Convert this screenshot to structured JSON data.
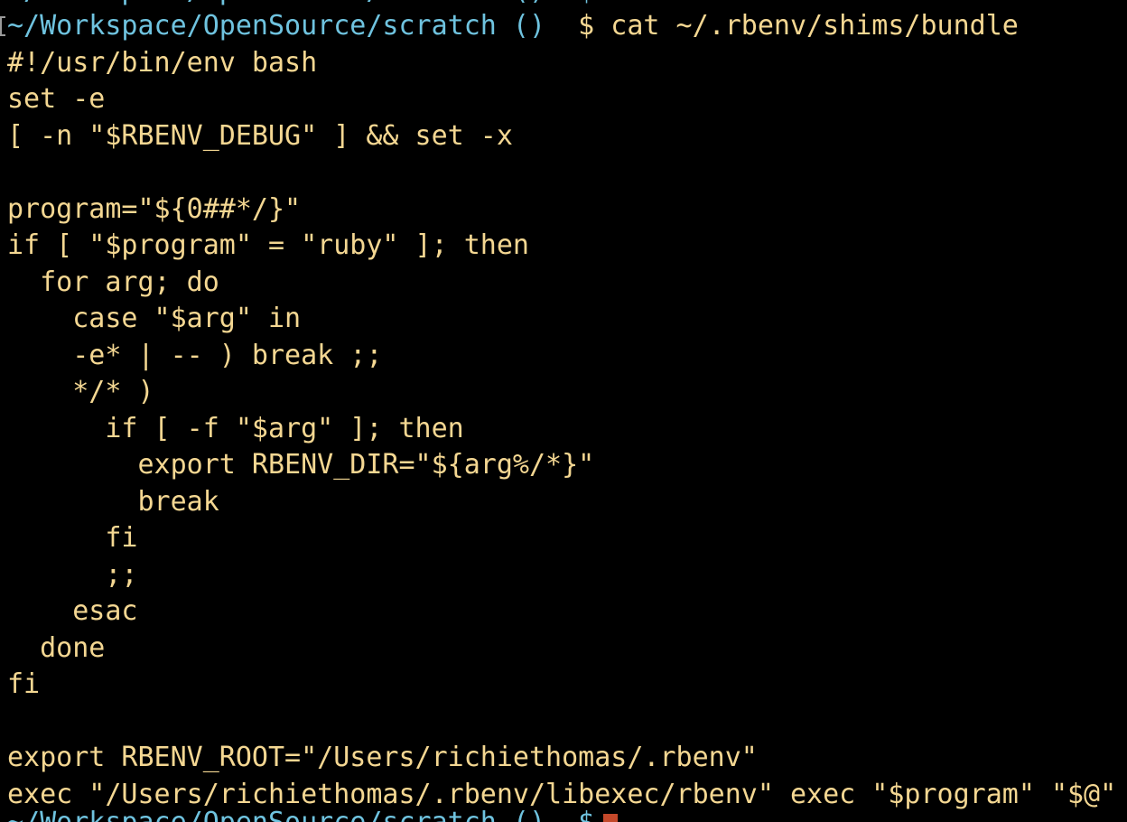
{
  "prompt": {
    "path": "~/Workspace/OpenSource/scratch ()",
    "symbol": "$",
    "command": "cat ~/.rbenv/shims/bundle"
  },
  "output_lines": [
    "#!/usr/bin/env bash",
    "set -e",
    "[ -n \"$RBENV_DEBUG\" ] && set -x",
    "",
    "program=\"${0##*/}\"",
    "if [ \"$program\" = \"ruby\" ]; then",
    "  for arg; do",
    "    case \"$arg\" in",
    "    -e* | -- ) break ;;",
    "    */* )",
    "      if [ -f \"$arg\" ]; then",
    "        export RBENV_DIR=\"${arg%/*}\"",
    "        break",
    "      fi",
    "      ;;",
    "    esac",
    "  done",
    "fi",
    "",
    "export RBENV_ROOT=\"/Users/richiethomas/.rbenv\"",
    "exec \"/Users/richiethomas/.rbenv/libexec/rbenv\" exec \"$program\" \"$@\""
  ],
  "partial_lines": {
    "top": "~/Workspace/OpenSource/scratch ()  $ ",
    "bottom": "~/Workspace/OpenSource/scratch ()  $ "
  },
  "colors": {
    "background": "#000000",
    "text": "#f4d792",
    "prompt_path": "#6fc3df",
    "cursor": "#c4482a"
  }
}
